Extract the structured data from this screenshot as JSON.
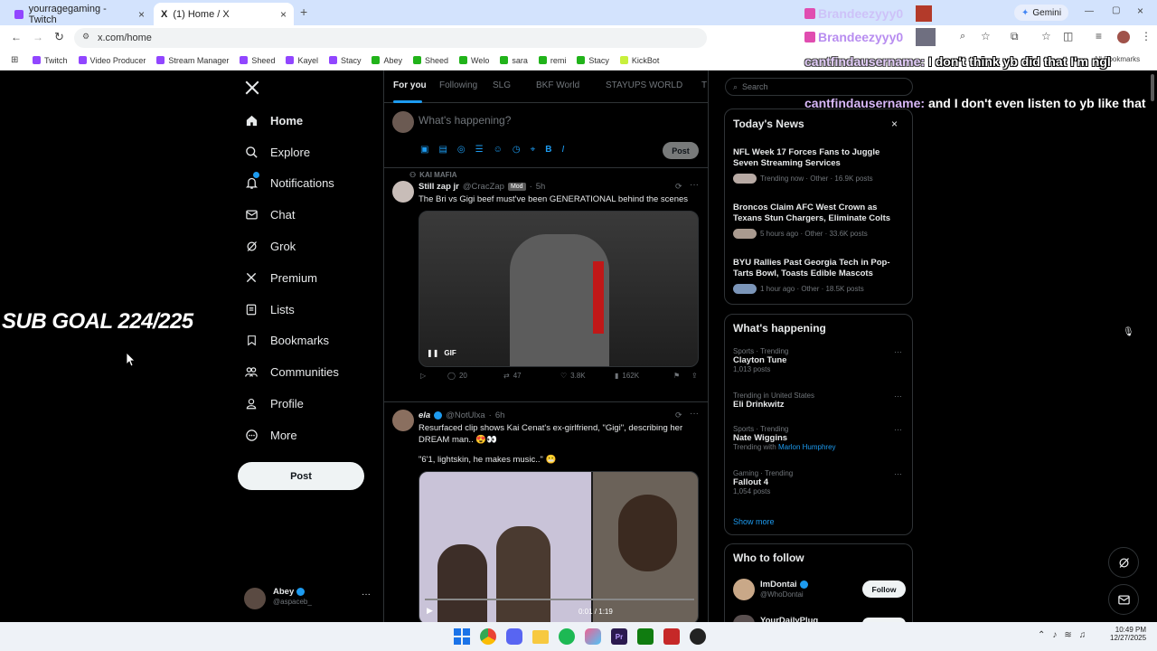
{
  "browser": {
    "tabs": [
      {
        "title": "yourragegaming - Twitch",
        "active": false
      },
      {
        "title": "(1) Home / X",
        "active": true
      }
    ],
    "url": "x.com/home",
    "gemini_label": "Gemini",
    "bookmarks": [
      "Twitch",
      "Video Producer",
      "Stream Manager",
      "Sheed",
      "Kayel",
      "Stacy",
      "Abey",
      "Sheed",
      "Welo",
      "sara",
      "remi",
      "Stacy",
      "KickBot"
    ],
    "all_bookmarks": "All Bookmarks"
  },
  "stream_overlay": {
    "sub_goal": "SUB GOAL 224/225",
    "chat": [
      {
        "user": "Brandeezyyy0",
        "message": ""
      },
      {
        "user": "Brandeezyyy0",
        "message": ""
      },
      {
        "user": "cantfindausername",
        "message": "I don't think yb did that I'm ngl"
      },
      {
        "user": "cantfindausername",
        "message": "and I don't even listen to yb like that"
      }
    ]
  },
  "sidebar": {
    "items": [
      {
        "label": "Home",
        "icon": "home-icon"
      },
      {
        "label": "Explore",
        "icon": "search-icon"
      },
      {
        "label": "Notifications",
        "icon": "bell-icon"
      },
      {
        "label": "Chat",
        "icon": "mail-icon"
      },
      {
        "label": "Grok",
        "icon": "grok-icon"
      },
      {
        "label": "Premium",
        "icon": "x-icon"
      },
      {
        "label": "Lists",
        "icon": "list-icon"
      },
      {
        "label": "Bookmarks",
        "icon": "bookmark-icon"
      },
      {
        "label": "Communities",
        "icon": "people-icon"
      },
      {
        "label": "Profile",
        "icon": "person-icon"
      },
      {
        "label": "More",
        "icon": "more-icon"
      }
    ],
    "post_label": "Post",
    "account": {
      "name": "Abey",
      "handle": "@aspaceb_"
    }
  },
  "feed": {
    "tabs": [
      "For you",
      "Following",
      "SLG",
      "BKF World",
      "STAYUPS WORLD",
      "TI"
    ],
    "compose_placeholder": "What's happening?",
    "compose_post": "Post",
    "tweets": [
      {
        "context": "KAI MAFIA",
        "name": "Still zap jr",
        "handle": "@CracZap",
        "badge": "Mod",
        "time": "5h",
        "text": "The Bri vs Gigi beef must've been GENERATIONAL behind the scenes",
        "media_label": "GIF",
        "replies": "20",
        "reposts": "47",
        "likes": "3.8K",
        "views": "162K"
      },
      {
        "name": "ela",
        "handle": "@NotUlxa",
        "time": "6h",
        "text": "Resurfaced clip shows Kai Cenat's ex-girlfriend, \"Gigi\", describing her DREAM man.. 😍👀",
        "quote": "\"6'1, lightskin, he makes music..\" 😬",
        "video_time": "0:01 / 1:19"
      }
    ]
  },
  "right": {
    "search_placeholder": "Search",
    "todays_news_title": "Today's News",
    "news": [
      {
        "title": "NFL Week 17 Forces Fans to Juggle Seven Streaming Services",
        "meta": "Trending now · Other · 16.9K posts"
      },
      {
        "title": "Broncos Claim AFC West Crown as Texans Stun Chargers, Eliminate Colts",
        "meta": "5 hours ago · Other · 33.6K posts"
      },
      {
        "title": "BYU Rallies Past Georgia Tech in Pop-Tarts Bowl, Toasts Edible Mascots",
        "meta": "1 hour ago · Other · 18.5K posts"
      }
    ],
    "whats_happening_title": "What's happening",
    "trends": [
      {
        "category": "Sports · Trending",
        "name": "Clayton Tune",
        "posts": "1,013 posts"
      },
      {
        "category": "Trending in United States",
        "name": "Eli Drinkwitz",
        "posts": ""
      },
      {
        "category": "Sports · Trending",
        "name": "Nate Wiggins",
        "posts": "Trending with",
        "with": "Marlon Humphrey"
      },
      {
        "category": "Gaming · Trending",
        "name": "Fallout 4",
        "posts": "1,054 posts"
      }
    ],
    "show_more": "Show more",
    "who_to_follow_title": "Who to follow",
    "follow": [
      {
        "name": "ImDontai",
        "handle": "@WhoDontai",
        "button": "Follow"
      },
      {
        "name": "YourDailyPlug",
        "handle": "",
        "button": "Follow"
      }
    ]
  },
  "taskbar": {
    "time": "10:49 PM",
    "date": "12/27/2025"
  }
}
